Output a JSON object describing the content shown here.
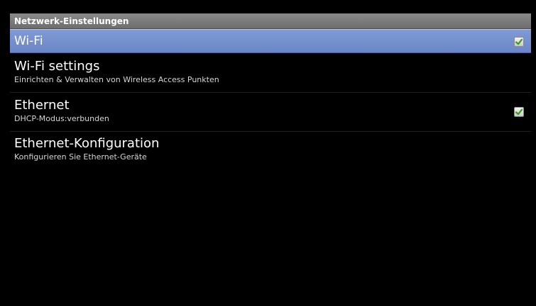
{
  "header": {
    "title": "Netzwerk-Einstellungen"
  },
  "items": [
    {
      "title": "Wi-Fi",
      "summary": "",
      "checked": true,
      "selected": true,
      "checkbox_icon": "checkmark-icon",
      "check_color": "#3a9a1c"
    },
    {
      "title": "Wi-Fi settings",
      "summary": "Einrichten & Verwalten von Wireless Access Punkten"
    },
    {
      "title": "Ethernet",
      "summary": "DHCP-Modus:verbunden",
      "checked": true,
      "checkbox_icon": "checkmark-icon",
      "check_color": "#3a9a1c"
    },
    {
      "title": "Ethernet-Konfiguration",
      "summary": "Konfigurieren Sie Ethernet-Geräte"
    }
  ],
  "colors": {
    "background": "#000000",
    "header_bg": "#7a7a7a",
    "selected_bg": "#7591d0",
    "title_text": "#ffffff",
    "summary_text": "#d6d6d6"
  }
}
